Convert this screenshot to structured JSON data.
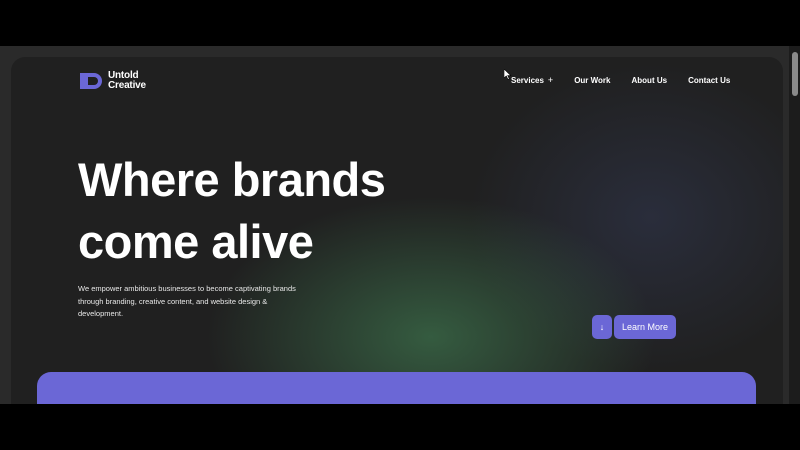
{
  "brand": {
    "line1": "Untold",
    "line2": "Creative",
    "accent_color": "#6b67d6"
  },
  "nav": {
    "items": [
      {
        "label": "Services",
        "icon": "plus-icon",
        "icon_glyph": "+"
      },
      {
        "label": "Our Work"
      },
      {
        "label": "About Us"
      },
      {
        "label": "Contact Us"
      }
    ]
  },
  "hero": {
    "title_line1": "Where brands",
    "title_line2": "come alive",
    "subtitle": "We empower ambitious businesses to become captivating brands through branding, creative content, and website design & development."
  },
  "cta": {
    "arrow_icon": "arrow-down-icon",
    "arrow_glyph": "↓",
    "label": "Learn More"
  }
}
